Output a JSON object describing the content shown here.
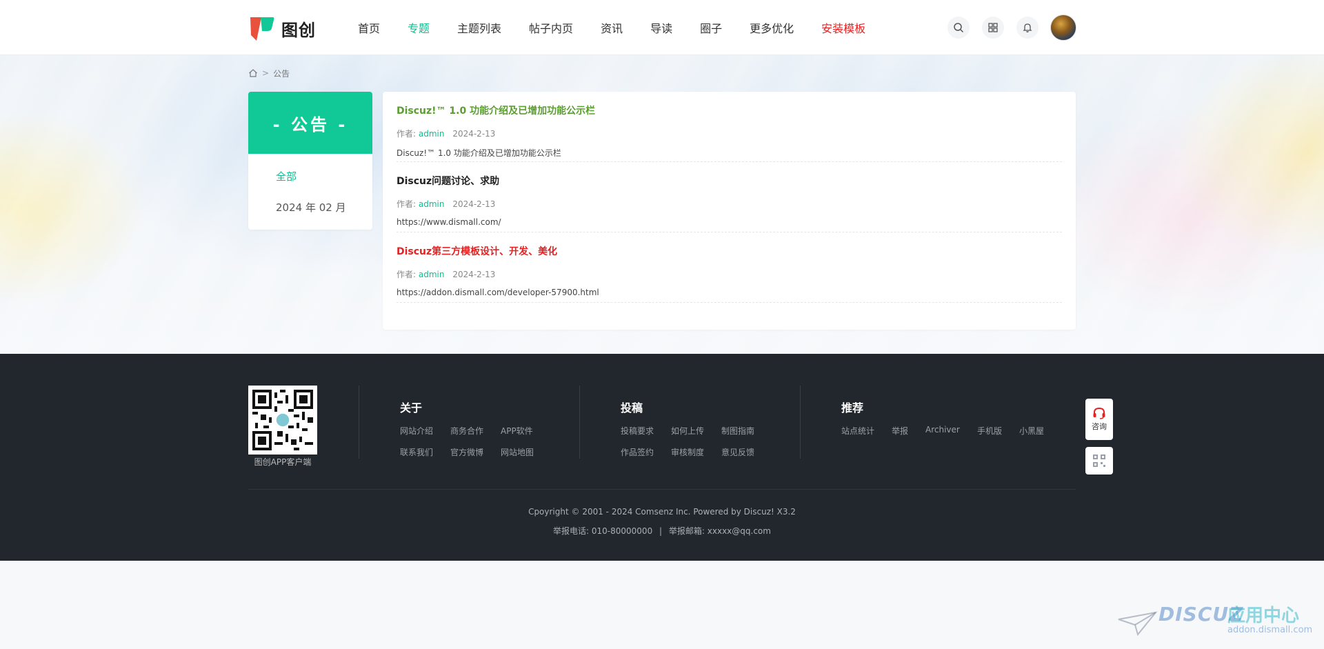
{
  "header": {
    "logo_text": "图创",
    "nav": [
      {
        "label": "首页",
        "state": "normal"
      },
      {
        "label": "专题",
        "state": "active"
      },
      {
        "label": "主题列表",
        "state": "normal"
      },
      {
        "label": "帖子内页",
        "state": "normal"
      },
      {
        "label": "资讯",
        "state": "normal"
      },
      {
        "label": "导读",
        "state": "normal"
      },
      {
        "label": "圈子",
        "state": "normal"
      },
      {
        "label": "更多优化",
        "state": "normal"
      },
      {
        "label": "安装模板",
        "state": "highlight"
      }
    ],
    "icons": [
      "search-icon",
      "grid-icon",
      "bell-icon"
    ]
  },
  "breadcrumb": {
    "home_icon": "home-icon",
    "separator": ">",
    "current": "公告"
  },
  "sidebar": {
    "title": "- 公告 -",
    "items": [
      {
        "label": "全部",
        "active": true
      },
      {
        "label": "2024 年 02 月",
        "active": false
      }
    ]
  },
  "posts": [
    {
      "title": "Discuz!™ 1.0 功能介绍及已增加功能公示栏",
      "title_color": "#5a9e2f",
      "author_prefix": "作者:",
      "author": "admin",
      "date": "2024-2-13",
      "summary": "Discuz!™ 1.0 功能介绍及已增加功能公示栏"
    },
    {
      "title": "Discuz问题讨论、求助",
      "title_color": "#222222",
      "author_prefix": "作者:",
      "author": "admin",
      "date": "2024-2-13",
      "summary": "https://www.dismall.com/"
    },
    {
      "title": "Discuz第三方模板设计、开发、美化",
      "title_color": "#e62121",
      "author_prefix": "作者:",
      "author": "admin",
      "date": "2024-2-13",
      "summary": "https://addon.dismall.com/developer-57900.html"
    }
  ],
  "footer": {
    "qr_label": "图创APP客户端",
    "columns": [
      {
        "title": "关于",
        "links": [
          "网站介绍",
          "商务合作",
          "APP软件",
          "联系我们",
          "官方微博",
          "网站地图"
        ]
      },
      {
        "title": "投稿",
        "links": [
          "投稿要求",
          "如何上传",
          "制图指南",
          "作品签约",
          "审核制度",
          "意见反馈"
        ]
      },
      {
        "title": "推荐",
        "links": [
          "站点统计",
          "举报",
          "Archiver",
          "手机版",
          "小黑屋"
        ]
      }
    ],
    "copyright": "Cpoyright © 2001 - 2024 Comsenz Inc. Powered by Discuz! X3.2",
    "report_phone": "举报电话: 010-80000000",
    "report_sep": "|",
    "report_email": "举报邮箱: xxxxx@qq.com"
  },
  "float": {
    "consult_label": "咨询",
    "consult_icon": "headset-icon",
    "qr_icon": "qrcode-icon"
  },
  "watermark": {
    "brand": "DISCUZ",
    "cn": "应用中心",
    "url": "addon.dismall.com"
  },
  "colors": {
    "accent": "#10c996",
    "nav_active": "#0bbf8f",
    "nav_highlight": "#e62121",
    "footer_bg": "#22262d"
  }
}
